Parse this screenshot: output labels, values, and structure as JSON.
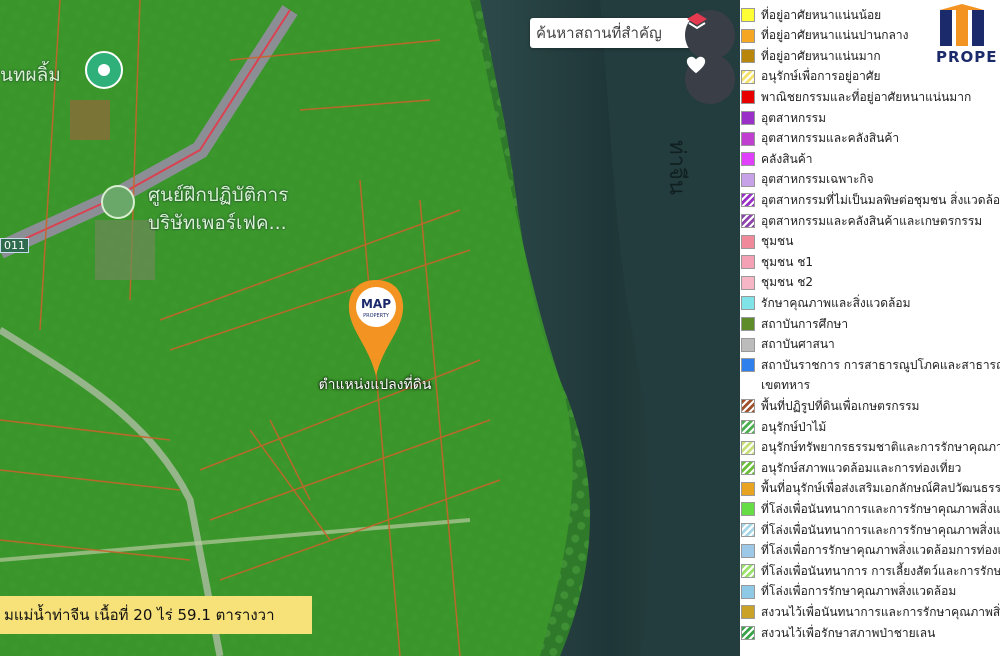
{
  "map": {
    "search_placeholder": "ค้นหาสถานที่สำคัญ",
    "layers_icon": "layers-icon",
    "favorite_icon": "heart-icon",
    "pin_brand": "MAP",
    "pin_brand_sub": "PROPERTY",
    "pin_label": "ตำแหน่งแปลงที่ดิน",
    "poi_1": "นทผลิ้ม",
    "poi_2_line1": "ศูนย์ฝึกปฏิบัติการ",
    "poi_2_line2": "บริษัทเพอร์เฟค...",
    "river_label": "ท่าจีน",
    "road_badge": "011",
    "info_bar": "มแม่น้ำท่าจีน   เนื้อที่ 20 ไร่ 59.1 ตารางวา"
  },
  "logo": {
    "text": "PROPE"
  },
  "legend": [
    {
      "label": "ที่อยู่อาศัยหนาแน่นน้อย",
      "color": "#ffff33",
      "pattern": "solid"
    },
    {
      "label": "ที่อยู่อาศัยหนาแน่นปานกลาง",
      "color": "#f5a623",
      "pattern": "solid"
    },
    {
      "label": "ที่อยู่อาศัยหนาแน่นมาก",
      "color": "#b8860b",
      "pattern": "solid"
    },
    {
      "label": "อนุรักษ์เพื่อการอยู่อาศัย",
      "color": "#f4e36b",
      "pattern": "hatch"
    },
    {
      "label": "พาณิชยกรรมและที่อยู่อาศัยหนาแน่นมาก",
      "color": "#e60000",
      "pattern": "solid"
    },
    {
      "label": "อุตสาหกรรม",
      "color": "#9b30c8",
      "pattern": "solid"
    },
    {
      "label": "อุตสาหกรรมและคลังสินค้า",
      "color": "#c03fd0",
      "pattern": "solid"
    },
    {
      "label": "คลังสินค้า",
      "color": "#e040fb",
      "pattern": "solid"
    },
    {
      "label": "อุตสาหกรรมเฉพาะกิจ",
      "color": "#c8a2e8",
      "pattern": "solid"
    },
    {
      "label": "อุตสาหกรรมที่ไม่เป็นมลพิษต่อชุมชน สิ่งแวดล้อม",
      "color": "#9b30c8",
      "pattern": "hatch"
    },
    {
      "label": "อุตสาหกรรมและคลังสินค้าและเกษตรกรรม",
      "color": "#8e44ad",
      "pattern": "hatch"
    },
    {
      "label": "ชุมชน",
      "color": "#f08a9a",
      "pattern": "solid"
    },
    {
      "label": "ชุมชน  ช1",
      "color": "#f4a0b5",
      "pattern": "solid"
    },
    {
      "label": "ชุมชน  ช2",
      "color": "#f7b6c6",
      "pattern": "solid"
    },
    {
      "label": "รักษาคุณภาพและสิ่งแวดล้อม",
      "color": "#7fe3e8",
      "pattern": "solid"
    },
    {
      "label": "สถาบันการศึกษา",
      "color": "#5e8c2a",
      "pattern": "solid"
    },
    {
      "label": "สถาบันศาสนา",
      "color": "#bbbbbb",
      "pattern": "solid"
    },
    {
      "label": "สถาบันราชการ การสาธารณูปโภคและสาธารณูปการ",
      "color": "#2f80ed",
      "pattern": "solid"
    },
    {
      "label": "เขตทหาร",
      "color": "#ffffff",
      "pattern": "none"
    },
    {
      "label": "พื้นที่ปฏิรูปที่ดินเพื่อเกษตรกรรม",
      "color": "#a0522d",
      "pattern": "hatch"
    },
    {
      "label": "อนุรักษ์ป่าไม้",
      "color": "#4caf50",
      "pattern": "hatch"
    },
    {
      "label": "อนุรักษ์ทรัพยากรธรรมชาติและการรักษาคุณภาพ",
      "color": "#c7e07a",
      "pattern": "hatch"
    },
    {
      "label": "อนุรักษ์สภาพแวดล้อมและการท่องเที่ยว",
      "color": "#6cbf3a",
      "pattern": "hatch"
    },
    {
      "label": "พื้นที่อนุรักษ์เพื่อส่งเสริมเอกลักษณ์ศิลปวัฒนธรรม",
      "color": "#e8a320",
      "pattern": "solid"
    },
    {
      "label": "ที่โล่งเพื่อนันทนาการและการรักษาคุณภาพสิ่งแวดล้อม",
      "color": "#66dd44",
      "pattern": "solid"
    },
    {
      "label": "ที่โล่งเพื่อนันทนาการและการรักษาคุณภาพสิ่งแวดล้อม",
      "color": "#a8d8e8",
      "pattern": "hatch"
    },
    {
      "label": "ที่โล่งเพื่อการรักษาคุณภาพสิ่งแวดล้อมการท่องเที่ยว",
      "color": "#9ec8e8",
      "pattern": "solid"
    },
    {
      "label": "ที่โล่งเพื่อนันทนาการ การเลี้ยงสัตว์และการรักษา",
      "color": "#9be26b",
      "pattern": "hatch"
    },
    {
      "label": "ที่โล่งเพื่อการรักษาคุณภาพสิ่งแวดล้อม",
      "color": "#8ecae6",
      "pattern": "solid"
    },
    {
      "label": "สงวนไว้เพื่อนันทนาการและการรักษาคุณภาพสิ่ง",
      "color": "#c9a227",
      "pattern": "solid"
    },
    {
      "label": "สงวนไว้เพื่อรักษาสภาพป่าชายเลน",
      "color": "#3aa34a",
      "pattern": "hatch"
    }
  ]
}
